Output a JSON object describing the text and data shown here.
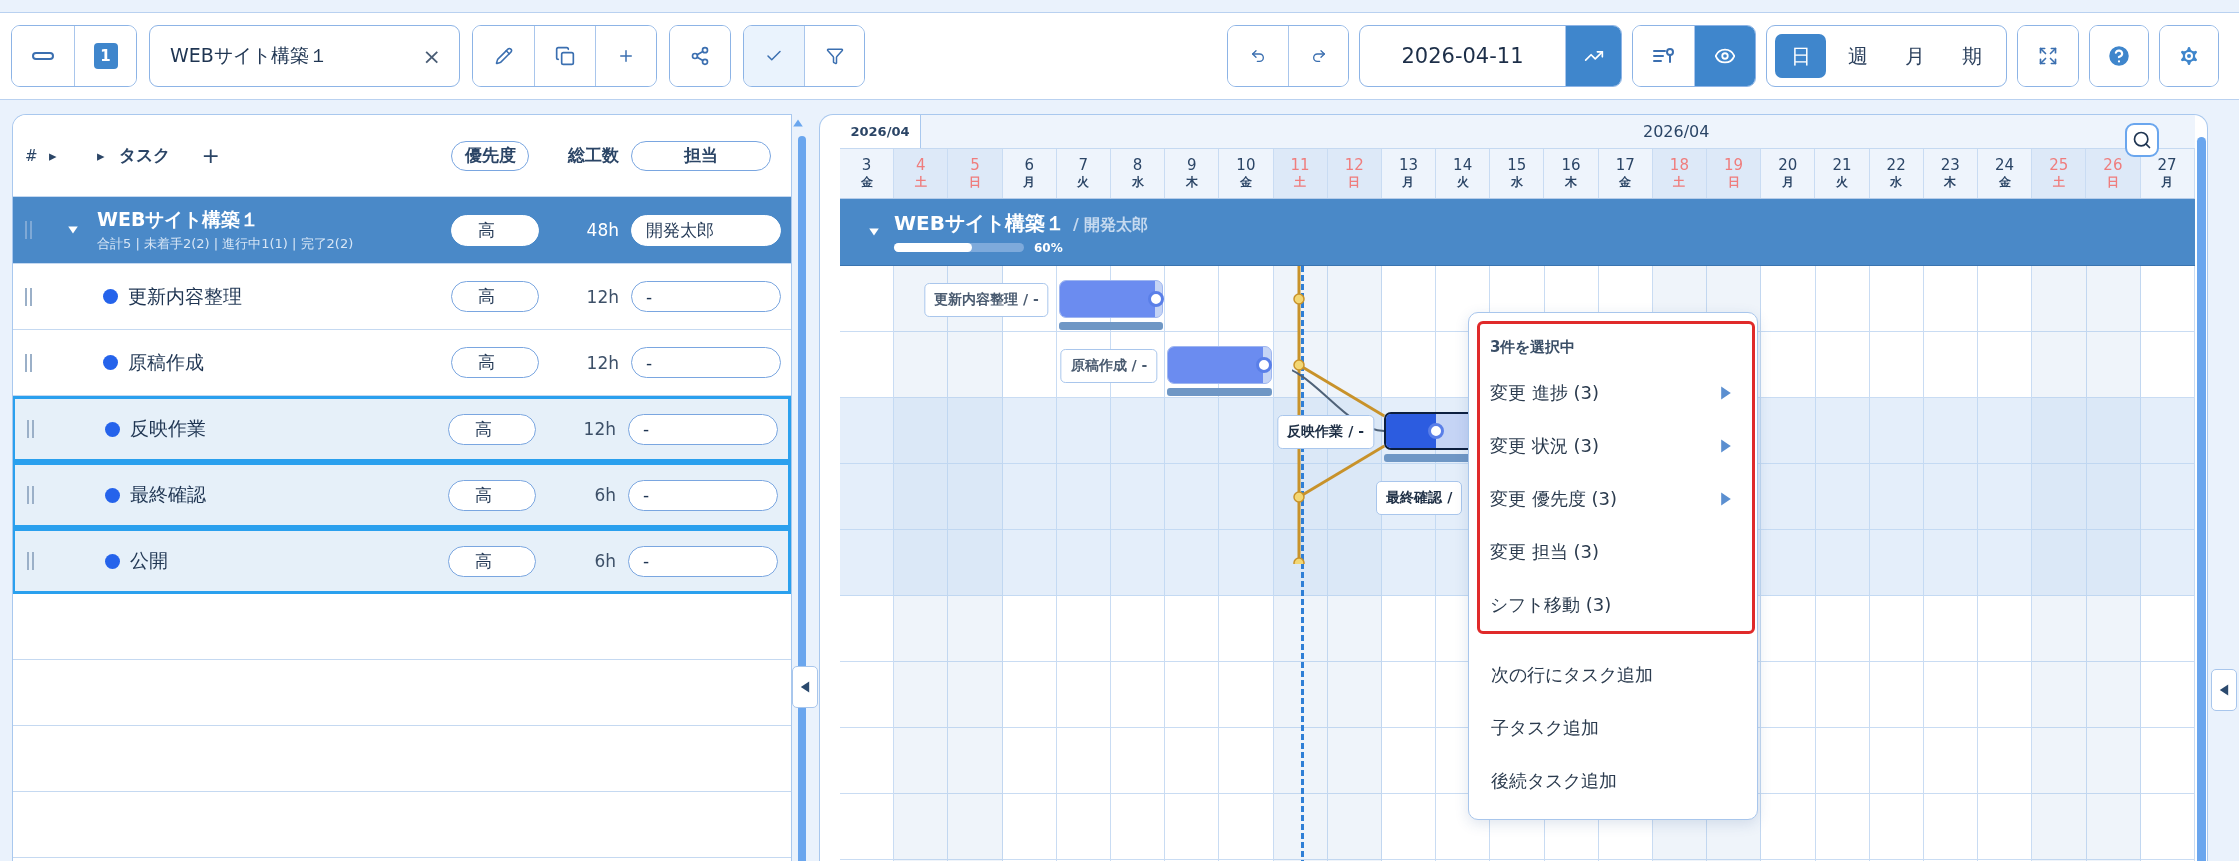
{
  "toolbar": {
    "badge": "1",
    "tab": {
      "label": "WEBサイト構築１",
      "close": "×"
    },
    "toggles": [
      {
        "kind": "check",
        "on": true
      },
      {
        "kind": "filter",
        "on": false
      }
    ],
    "date": "2026-04-11",
    "trend_on": true,
    "views": [
      {
        "kind": "fields",
        "on": false
      },
      {
        "kind": "eye",
        "on": true
      }
    ],
    "scales": [
      {
        "label": "日",
        "selected": true
      },
      {
        "label": "週",
        "selected": false
      },
      {
        "label": "月",
        "selected": false
      },
      {
        "label": "期",
        "selected": false
      }
    ]
  },
  "task_table": {
    "columns": {
      "number": "#",
      "expand_all": "▸",
      "expand": "▸",
      "task": "タスク",
      "add": "+",
      "priority": "優先度",
      "hours": "総工数",
      "assignee": "担当"
    },
    "project": {
      "name": "WEBサイト構築１",
      "summary": "合計5 | 未着手2(2) | 進行中1(1) | 完了2(2)",
      "priority": "高",
      "hours": "48h",
      "assignee": "開発太郎",
      "expanded": true
    },
    "tasks": [
      {
        "name": "更新内容整理",
        "color": "#2563eb",
        "priority": "高",
        "hours": "12h",
        "assignee": "-",
        "selected": false,
        "gantt": {
          "kind": "bar",
          "label": "更新内容整理 / -",
          "level": 0.93,
          "focused": false
        }
      },
      {
        "name": "原稿作成",
        "color": "#2563eb",
        "priority": "高",
        "hours": "12h",
        "assignee": "-",
        "selected": false,
        "gantt": {
          "kind": "bar",
          "label": "原稿作成 / -",
          "level": 0.93,
          "focused": false
        }
      },
      {
        "name": "反映作業",
        "color": "#2563eb",
        "priority": "高",
        "hours": "12h",
        "assignee": "-",
        "selected": true,
        "gantt": {
          "kind": "bar",
          "label": "反映作業 / -",
          "level": 0.5,
          "focused": true
        }
      },
      {
        "name": "最終確認",
        "color": "#2563eb",
        "priority": "高",
        "hours": "6h",
        "assignee": "-",
        "selected": true,
        "gantt": {
          "kind": "label",
          "label": "最終確認 /"
        }
      },
      {
        "name": "公開",
        "color": "#2563eb",
        "priority": "高",
        "hours": "6h",
        "assignee": "-",
        "selected": true
      }
    ]
  },
  "gantt": {
    "month_tab": "2026/04",
    "month": "2026/04",
    "days": [
      {
        "day": "3",
        "weekday": "金",
        "holiday": false
      },
      {
        "day": "4",
        "weekday": "土",
        "holiday": true
      },
      {
        "day": "5",
        "weekday": "日",
        "holiday": true
      },
      {
        "day": "6",
        "weekday": "月",
        "holiday": false
      },
      {
        "day": "7",
        "weekday": "火",
        "holiday": false
      },
      {
        "day": "8",
        "weekday": "水",
        "holiday": false
      },
      {
        "day": "9",
        "weekday": "木",
        "holiday": false
      },
      {
        "day": "10",
        "weekday": "金",
        "holiday": false
      },
      {
        "day": "11",
        "weekday": "土",
        "holiday": true
      },
      {
        "day": "12",
        "weekday": "日",
        "holiday": true
      },
      {
        "day": "13",
        "weekday": "月",
        "holiday": false
      },
      {
        "day": "14",
        "weekday": "火",
        "holiday": false
      },
      {
        "day": "15",
        "weekday": "水",
        "holiday": false
      },
      {
        "day": "16",
        "weekday": "木",
        "holiday": false
      },
      {
        "day": "17",
        "weekday": "金",
        "holiday": false
      },
      {
        "day": "18",
        "weekday": "土",
        "holiday": true
      },
      {
        "day": "19",
        "weekday": "日",
        "holiday": true
      },
      {
        "day": "20",
        "weekday": "月",
        "holiday": false
      },
      {
        "day": "21",
        "weekday": "火",
        "holiday": false
      },
      {
        "day": "22",
        "weekday": "水",
        "holiday": false
      },
      {
        "day": "23",
        "weekday": "木",
        "holiday": false
      },
      {
        "day": "24",
        "weekday": "金",
        "holiday": false
      },
      {
        "day": "25",
        "weekday": "土",
        "holiday": true
      },
      {
        "day": "26",
        "weekday": "日",
        "holiday": true
      },
      {
        "day": "27",
        "weekday": "月",
        "holiday": false
      }
    ],
    "project_bar": {
      "name": "WEBサイト構築１",
      "owner": "/ 開発太郎",
      "level": 0.6,
      "progress": "60%",
      "expanded": true
    }
  },
  "context_menu": {
    "highlighted": {
      "title": "3件を選択中",
      "items": [
        {
          "label": "変更 進捗 (3)",
          "submenu": true
        },
        {
          "label": "変更 状況 (3)",
          "submenu": true
        },
        {
          "label": "変更 優先度 (3)",
          "submenu": true
        },
        {
          "label": "変更 担当 (3)",
          "submenu": false
        },
        {
          "label": "シフト移動 (3)",
          "submenu": false
        }
      ]
    },
    "items": [
      {
        "label": "次の行にタスク追加",
        "submenu": false
      },
      {
        "label": "子タスク追加",
        "submenu": false
      },
      {
        "label": "後続タスク追加",
        "submenu": false
      }
    ]
  }
}
